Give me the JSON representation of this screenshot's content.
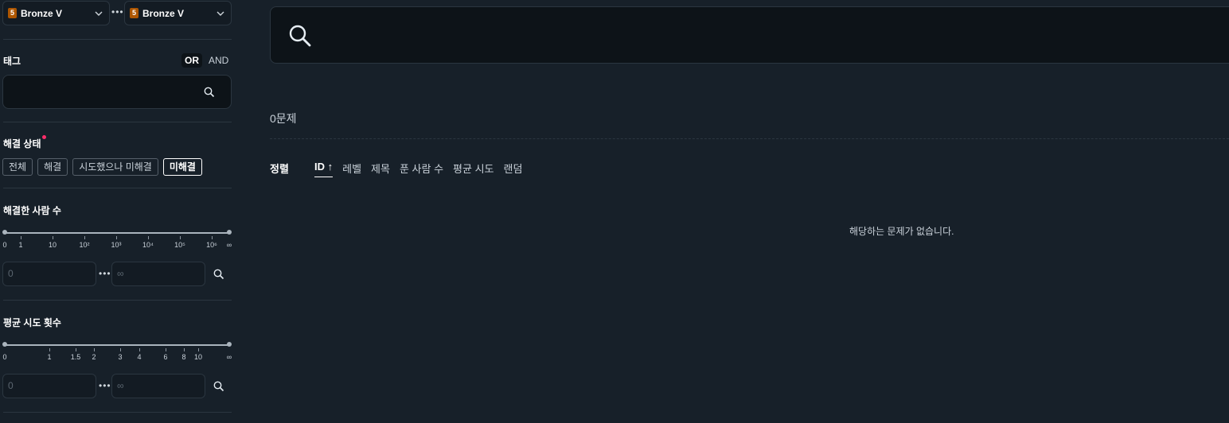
{
  "tier_filter": {
    "min_label": "Bronze V",
    "max_label": "Bronze V",
    "badge_text": "5",
    "badge_color": "#ad5600",
    "separator": "•••"
  },
  "tags": {
    "title": "태그",
    "logic_or": "OR",
    "logic_and": "AND",
    "selected_logic": "OR",
    "input_value": ""
  },
  "solve_status": {
    "title": "해결 상태",
    "options": [
      "전체",
      "해결",
      "시도했으나 미해결",
      "미해결"
    ],
    "selected": "미해결"
  },
  "solvers": {
    "title": "해결한 사람 수",
    "ticks": [
      "0",
      "1",
      "10",
      "10²",
      "10³",
      "10⁴",
      "10⁵",
      "10⁶",
      "∞"
    ],
    "min_placeholder": "0",
    "max_placeholder": "∞",
    "separator": "•••"
  },
  "avg_tries": {
    "title": "평균 시도 횟수",
    "ticks": [
      "0",
      "1",
      "1.5",
      "2",
      "3",
      "4",
      "6",
      "8",
      "10",
      "∞"
    ],
    "min_placeholder": "0",
    "max_placeholder": "∞",
    "separator": "•••"
  },
  "main": {
    "search_value": "",
    "result_count": "0문제",
    "sort_label": "정렬",
    "sort_options": [
      "ID ↑",
      "레벨",
      "제목",
      "푼 사람 수",
      "평균 시도",
      "랜덤"
    ],
    "sort_selected": "ID",
    "sort_direction": "ascending",
    "empty_message": "해당하는 문제가 없습니다."
  },
  "colors": {
    "background": "#172029",
    "input_background": "#0d1318",
    "accent_dot": "#ff2d6a",
    "bronze": "#ad5600"
  }
}
